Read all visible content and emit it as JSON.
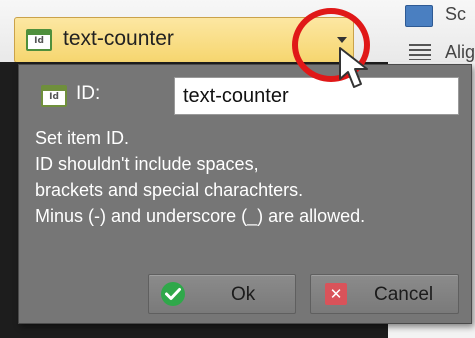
{
  "toolbar": {
    "combo_value": "text-counter",
    "combo_icon_text": "Id",
    "right_item_1": "Sc",
    "right_item_2": "Alig"
  },
  "popup": {
    "id_icon_text": "Id",
    "id_label": "ID:",
    "id_value": "text-counter",
    "description_lines": [
      "Set item ID.",
      "ID shouldn't include spaces,",
      "brackets and special charachters.",
      "Minus (-) and underscore (_) are allowed."
    ],
    "ok_label": "Ok",
    "cancel_label": "Cancel",
    "cancel_icon_glyph": "✕"
  },
  "colors": {
    "combo_bg": "#f6d66f",
    "popup_bg": "#767676",
    "highlight": "#e01818",
    "ok_icon": "#2fa84a",
    "cancel_icon": "#d9535a"
  },
  "icons": {
    "combo": "id-badge-icon",
    "dropdown": "chevron-down-icon",
    "cursor": "mouse-pointer-icon",
    "ok": "check-circle-icon",
    "cancel": "x-square-icon"
  }
}
